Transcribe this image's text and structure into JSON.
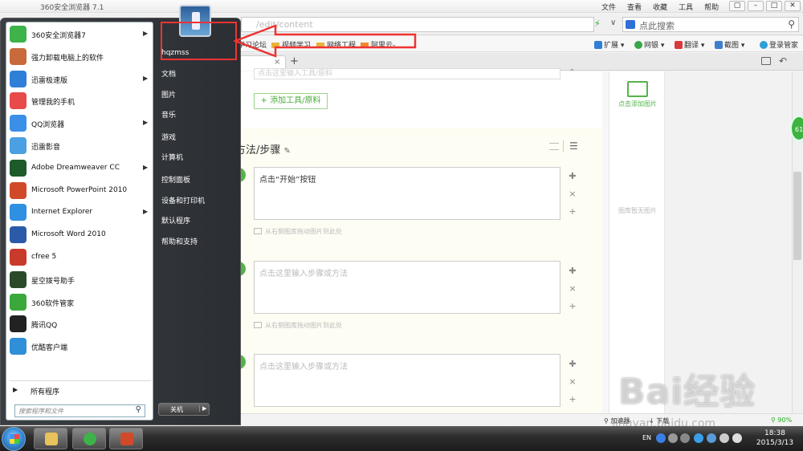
{
  "browser": {
    "title": "360安全浏览器 7.1",
    "menu": [
      "文件",
      "查看",
      "收藏",
      "工具",
      "帮助"
    ],
    "window_buttons": [
      "▢",
      "–",
      "□",
      "✕"
    ],
    "url_value": "/edit/content",
    "search_placeholder": "点此搜索"
  },
  "bookmarks": [
    {
      "label": "学习论坛"
    },
    {
      "label": "视频学习"
    },
    {
      "label": "网络工程"
    },
    {
      "label": "阿里云-"
    }
  ],
  "toolbar": [
    {
      "label": "扩展",
      "color": "#2f7fd8"
    },
    {
      "label": "网银",
      "color": "#3aa54a"
    },
    {
      "label": "翻译",
      "color": "#d83a3a"
    },
    {
      "label": "截图",
      "color": "#3f7fd0"
    },
    {
      "label": "登录管家",
      "color": "#2f9fd8"
    }
  ],
  "tab": {
    "close": "×",
    "new": "+"
  },
  "editor": {
    "top_placeholder": "点击这里输入工具/原料",
    "add_tool": "+ 添加工具/原料",
    "heading": "方法/步骤",
    "steps": [
      {
        "text": "点击“开始”按钮",
        "placeholder": false
      },
      {
        "text": "点击这里输入步骤或方法",
        "placeholder": true
      },
      {
        "text": "点击这里输入步骤或方法",
        "placeholder": true
      }
    ],
    "drag_hint": "从右侧图库拖动图片到此处",
    "controls": [
      "✚",
      "×",
      "+"
    ]
  },
  "gallery": {
    "add_label": "点击添加图片",
    "empty_label": "图库暂无图片"
  },
  "green_badge": "61",
  "status": {
    "accelerator": "加速器",
    "download": "下载",
    "zoom": "90%"
  },
  "start_menu": {
    "programs": [
      {
        "label": "360安全浏览器7",
        "arrow": true,
        "color": "#3db34a"
      },
      {
        "label": "强力卸载电脑上的软件",
        "arrow": false,
        "color": "#c86a3a"
      },
      {
        "label": "迅雷极速版",
        "arrow": true,
        "color": "#2f7fd8"
      },
      {
        "label": "管理我的手机",
        "arrow": false,
        "color": "#e84a4a"
      },
      {
        "label": "QQ浏览器",
        "arrow": true,
        "color": "#3a8fe8"
      },
      {
        "label": "迅雷影音",
        "arrow": false,
        "color": "#4aa0e0"
      },
      {
        "label": "Adobe Dreamweaver CC",
        "arrow": true,
        "color": "#1e5a2a"
      },
      {
        "label": "Microsoft PowerPoint 2010",
        "arrow": false,
        "color": "#d04a2a"
      },
      {
        "label": "Internet Explorer",
        "arrow": true,
        "color": "#2f8fe0"
      },
      {
        "label": "Microsoft Word 2010",
        "arrow": false,
        "color": "#2a5aa8"
      },
      {
        "label": "cfree 5",
        "arrow": false,
        "color": "#c83a2a"
      },
      {
        "label": "星空拨号助手",
        "arrow": false,
        "color": "#2a4a2a"
      },
      {
        "label": "360软件管家",
        "arrow": false,
        "color": "#3aa83a"
      },
      {
        "label": "腾讯QQ",
        "arrow": false,
        "color": "#222222"
      },
      {
        "label": "优酷客户端",
        "arrow": false,
        "color": "#2f8fd8"
      }
    ],
    "all_programs": "所有程序",
    "search_placeholder": "搜索程序和文件",
    "user": "hqzmss",
    "right_links": [
      "文档",
      "图片",
      "音乐",
      "游戏",
      "计算机",
      "控制面板",
      "设备和打印机",
      "默认程序",
      "帮助和支持"
    ],
    "shutdown": "关机"
  },
  "taskbar": {
    "lang": "EN",
    "time": "18:38",
    "date": "2015/3/13"
  },
  "watermark": {
    "main": "Bai经验",
    "sub": "jingyan.baidu.com"
  },
  "colors": {
    "accent_green": "#56b34a",
    "highlight_red": "#e33333"
  }
}
